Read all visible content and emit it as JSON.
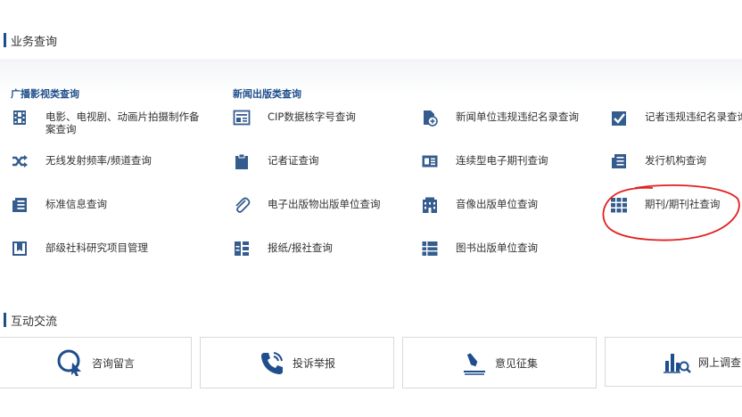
{
  "section1": {
    "title": "业务查询"
  },
  "categories": {
    "cat1": "广播影视类查询",
    "cat2": "新闻出版类查询"
  },
  "items": [
    {
      "label": "电影、电视剧、动画片拍摄制作备案查询",
      "icon": "film-icon"
    },
    {
      "label": "无线发射频率/频道查询",
      "icon": "shuffle-icon"
    },
    {
      "label": "标准信息查询",
      "icon": "document-icon"
    },
    {
      "label": "部级社科研究项目管理",
      "icon": "bookmark-icon"
    },
    {
      "label": "CIP数据核字号查询",
      "icon": "id-card-icon"
    },
    {
      "label": "记者证查询",
      "icon": "clipboard-icon"
    },
    {
      "label": "电子出版物出版单位查询",
      "icon": "paperclip-icon"
    },
    {
      "label": "报纸/报社查询",
      "icon": "newspaper-icon"
    },
    {
      "label": "新闻单位违规违纪名录查询",
      "icon": "file-add-icon"
    },
    {
      "label": "连续型电子期刊查询",
      "icon": "card-icon"
    },
    {
      "label": "音像出版单位查询",
      "icon": "building-icon"
    },
    {
      "label": "图书出版单位查询",
      "icon": "list-icon"
    },
    {
      "label": "记者违规违纪名录查询",
      "icon": "checkbox-icon"
    },
    {
      "label": "发行机构查询",
      "icon": "paper-icon"
    },
    {
      "label": "期刊/期刊社查询",
      "icon": "grid-icon"
    }
  ],
  "section2": {
    "title": "互动交流"
  },
  "cards": [
    {
      "label": "咨询留言",
      "icon": "inquiry-icon"
    },
    {
      "label": "投诉举报",
      "icon": "phone-icon"
    },
    {
      "label": "意见征集",
      "icon": "pen-icon"
    },
    {
      "label": "网上调查",
      "icon": "survey-icon"
    }
  ],
  "colors": {
    "accent": "#1f4e8c",
    "icon": "#355c8f",
    "annotation": "#e02020"
  }
}
